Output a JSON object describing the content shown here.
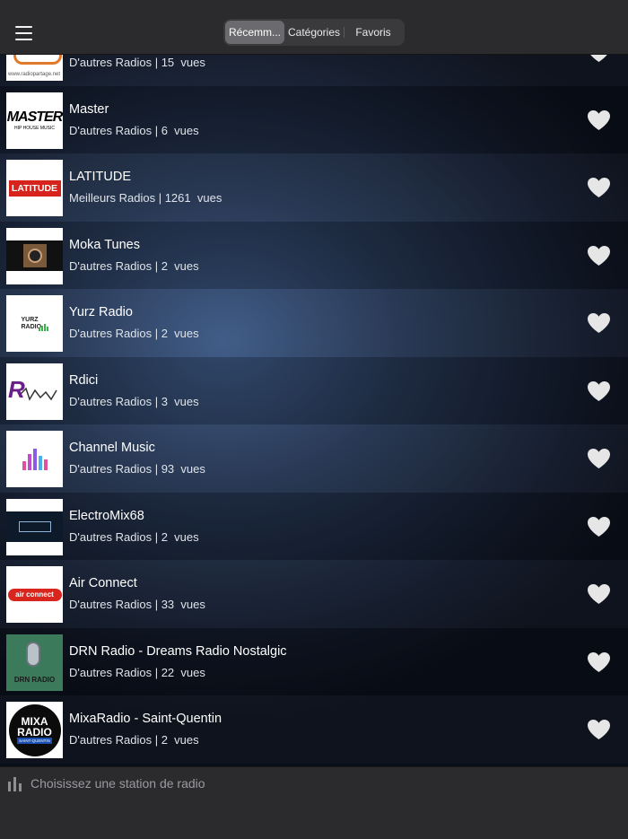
{
  "tabs": [
    {
      "label": "Récemm...",
      "active": true
    },
    {
      "label": "Catégories",
      "active": false
    },
    {
      "label": "Favoris",
      "active": false
    }
  ],
  "stations": [
    {
      "name": "",
      "category": "D'autres Radios",
      "views": "15",
      "logo": "radiopartage-logo"
    },
    {
      "name": "Master",
      "category": "D'autres Radios",
      "views": "6",
      "logo": "master-logo"
    },
    {
      "name": "LATITUDE",
      "category": "Meilleurs Radios",
      "views": "1261",
      "logo": "latitude-logo"
    },
    {
      "name": "Moka Tunes",
      "category": "D'autres Radios",
      "views": "2",
      "logo": "moka-tunes-logo"
    },
    {
      "name": "Yurz Radio",
      "category": "D'autres Radios",
      "views": "2",
      "logo": "yurz-radio-logo"
    },
    {
      "name": "Rdici",
      "category": "D'autres Radios",
      "views": "3",
      "logo": "rdici-logo"
    },
    {
      "name": "Channel Music",
      "category": "D'autres Radios",
      "views": "93",
      "logo": "channel-music-logo"
    },
    {
      "name": "ElectroMix68",
      "category": "D'autres Radios",
      "views": "2",
      "logo": "electromix68-logo"
    },
    {
      "name": "Air Connect",
      "category": "D'autres Radios",
      "views": "33",
      "logo": "air-connect-logo"
    },
    {
      "name": "DRN Radio - Dreams Radio Nostalgic",
      "category": "D'autres Radios",
      "views": "22",
      "logo": "drn-radio-logo"
    },
    {
      "name": "MixaRadio - Saint-Quentin",
      "category": "D'autres Radios",
      "views": "2",
      "logo": "mixaradio-logo"
    }
  ],
  "views_suffix": "vues",
  "logos": {
    "master": "MASTER",
    "master_sub": "HIP HOUSE MUSIC",
    "latitude": "LATITUDE",
    "yurz": "YURZ RADIO",
    "drn": "DRN RADIO",
    "mixa_line1": "MIXA",
    "mixa_line2": "RADIO",
    "mixa_line3": "SAINT-QUENTIN",
    "air": "air connect",
    "radiopartage": "www.radiopartage.net"
  },
  "player": {
    "prompt": "Choisissez une station de radio"
  },
  "colors": {
    "bar": "#2b2b2d",
    "heart": "#e6e6e6",
    "accent_tab": "#6b6b6f"
  }
}
